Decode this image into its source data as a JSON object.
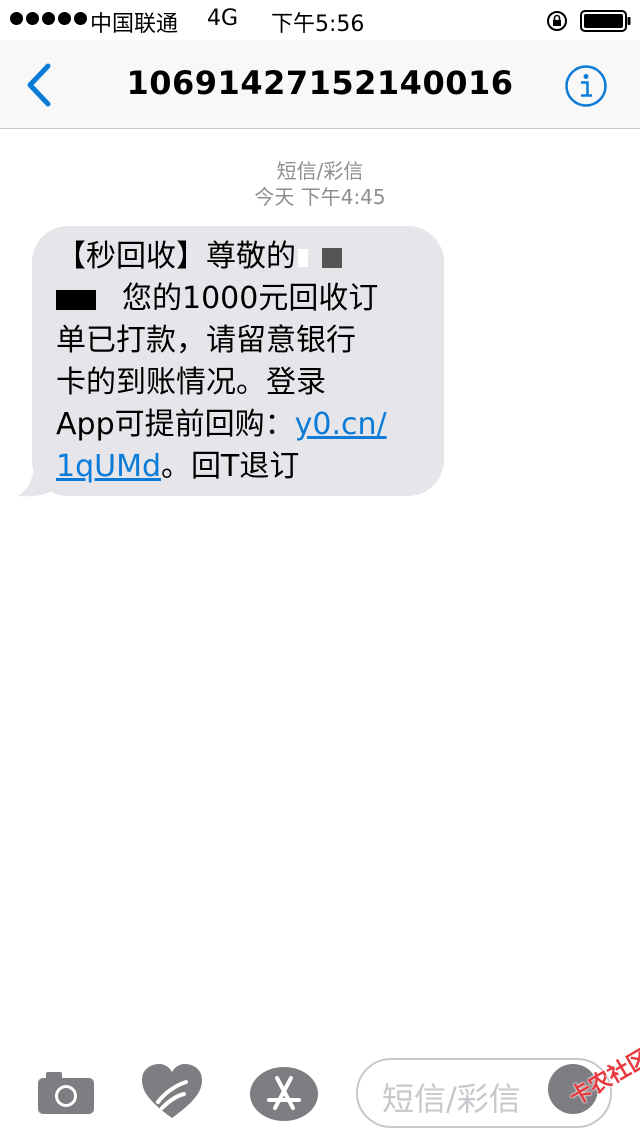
{
  "status_bar": {
    "carrier": "中国联通",
    "network": "4G",
    "time": "下午5:56"
  },
  "nav": {
    "title": "10691427152140016"
  },
  "conversation": {
    "type": "短信/彩信",
    "timestamp": "今天 下午4:45",
    "message": {
      "line1": "【秒回收】尊敬的",
      "line2": "您的1000元回收订",
      "line3": "单已打款，请留意银行",
      "line4": "卡的到账情况。登录",
      "line5_prefix": "App可提前回购：",
      "link_part1": "y0.cn/",
      "link_part2": "1qUMd",
      "suffix": "。回T退订"
    }
  },
  "input": {
    "placeholder": "短信/彩信"
  },
  "watermark": {
    "text": "卡农社区"
  },
  "colors": {
    "accent": "#0b7bd8",
    "bubble": "#e5e5ea",
    "meta": "#8e8e93",
    "watermark": "#e8383d"
  }
}
